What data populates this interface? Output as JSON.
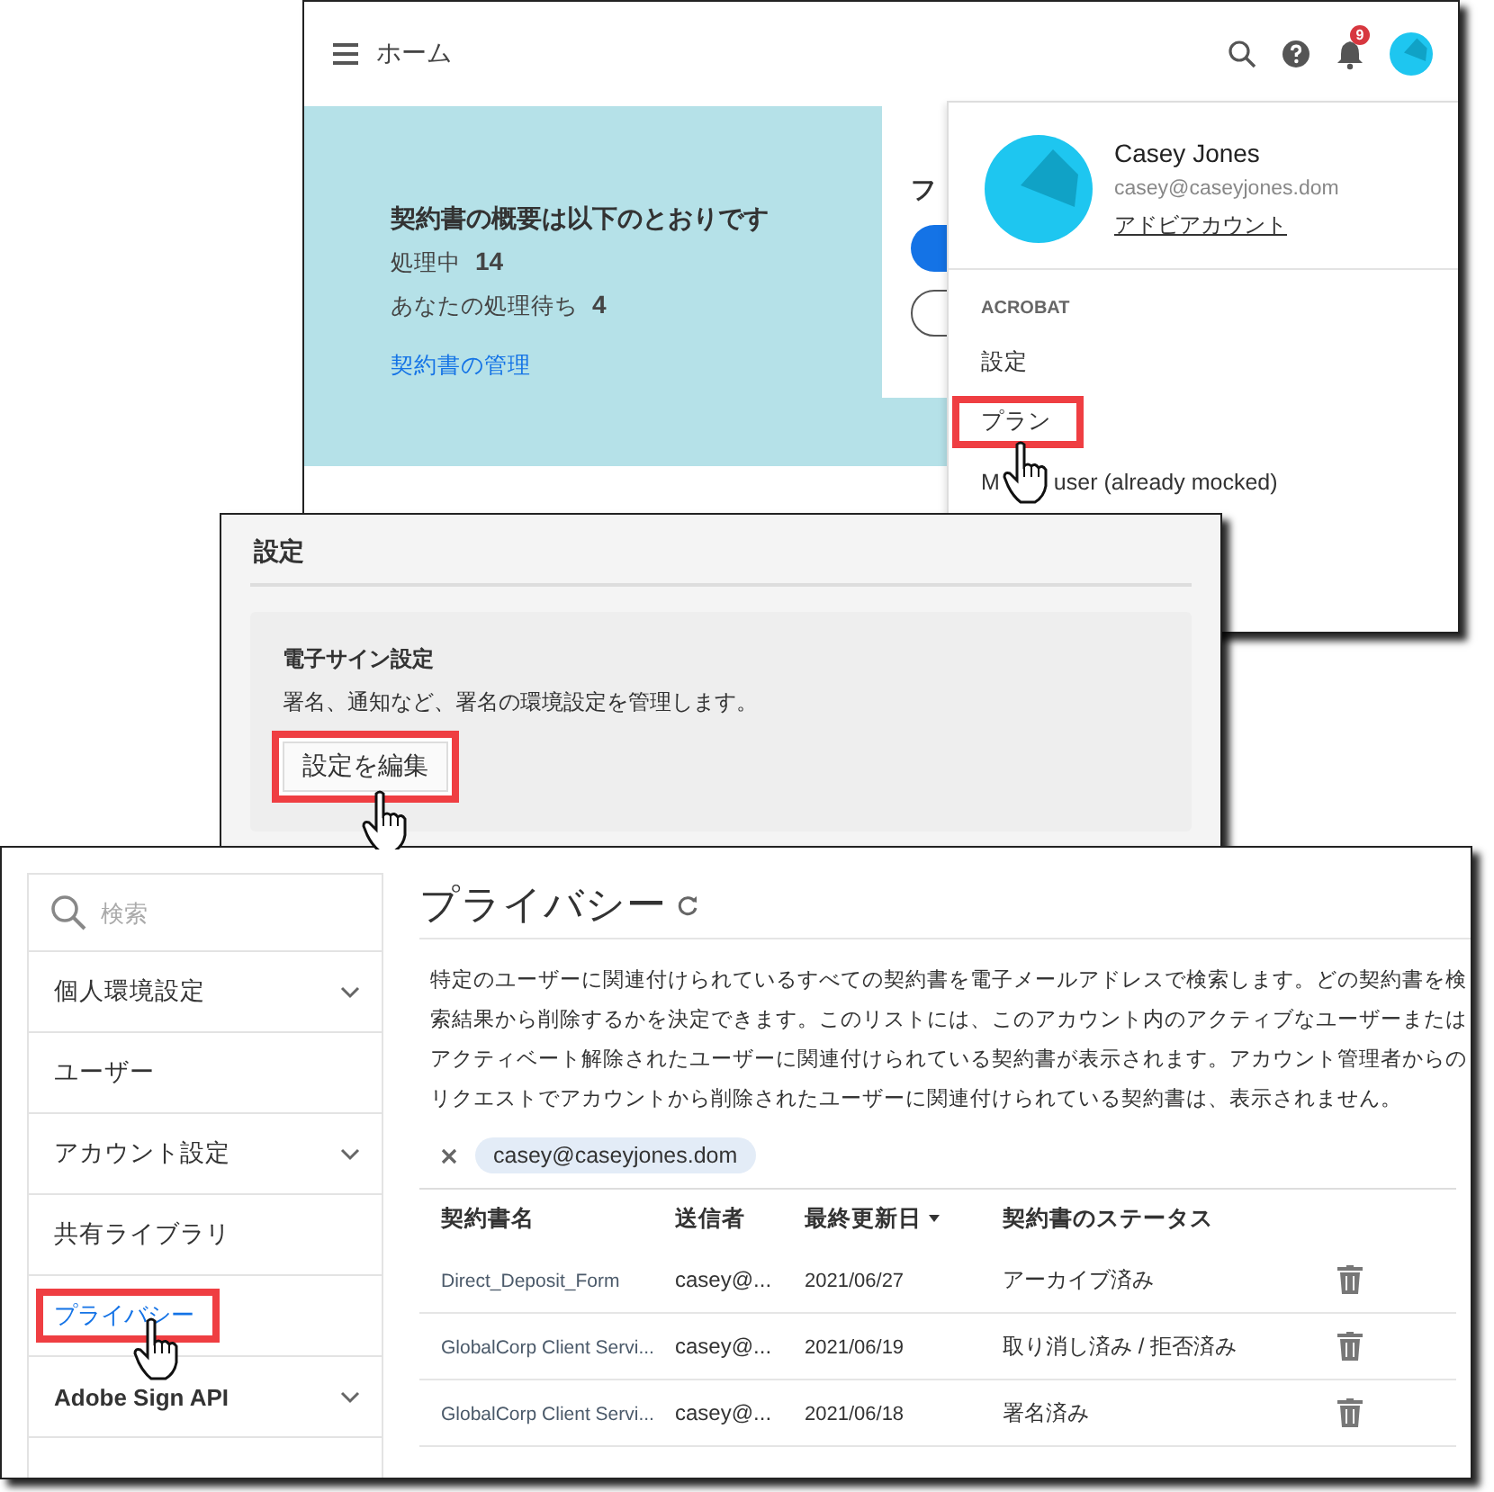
{
  "home_window": {
    "header": {
      "title": "ホーム",
      "notification_count": "9"
    },
    "summary": {
      "heading": "契約書の概要は以下のとおりです",
      "stats": [
        {
          "label": "処理中",
          "value": "14"
        },
        {
          "label": "あなたの処理待ち",
          "value": "4"
        }
      ],
      "link": "契約書の管理"
    },
    "card": {
      "heading": "フ"
    },
    "account_menu": {
      "name": "Casey Jones",
      "email": "casey@caseyjones.dom",
      "account_link": "アドビアカウント",
      "section": "ACROBAT",
      "items": [
        {
          "label": "設定",
          "highlighted": false
        },
        {
          "label": "プラン",
          "highlighted": true
        },
        {
          "label": "M",
          "trailing": "user (already mocked)",
          "highlighted": false
        }
      ]
    }
  },
  "settings_window": {
    "title": "設定",
    "section": {
      "heading": "電子サイン設定",
      "description": "署名、通知など、署名の環境設定を管理します。",
      "button": "設定を編集",
      "highlighted": true
    }
  },
  "privacy_window": {
    "search": {
      "placeholder": "検索"
    },
    "nav": [
      {
        "label": "個人環境設定",
        "expandable": true,
        "emphasized": false,
        "selected": false
      },
      {
        "label": "ユーザー",
        "expandable": false,
        "emphasized": false,
        "selected": false
      },
      {
        "label": "アカウント設定",
        "expandable": true,
        "emphasized": false,
        "selected": false
      },
      {
        "label": "共有ライブラリ",
        "expandable": false,
        "emphasized": false,
        "selected": false
      },
      {
        "label": "プライバシー",
        "expandable": false,
        "emphasized": false,
        "selected": true
      },
      {
        "label": "Adobe Sign API",
        "expandable": true,
        "emphasized": true,
        "selected": false
      }
    ],
    "title": "プライバシー",
    "description": "特定のユーザーに関連付けられているすべての契約書を電子メールアドレスで検索します。どの契約書を検索結果から削除するかを決定できます。このリストには、このアカウント内のアクティブなユーザーまたはアクティベート解除されたユーザーに関連付けられている契約書が表示されます。アカウント管理者からのリクエストでアカウントから削除されたユーザーに関連付けられている契約書は、表示されません。",
    "filter_chip": "casey@caseyjones.dom",
    "table": {
      "columns": [
        {
          "label": "契約書名",
          "sorted": false
        },
        {
          "label": "送信者",
          "sorted": false
        },
        {
          "label": "最終更新日",
          "sorted": true
        },
        {
          "label": "契約書のステータス",
          "sorted": false
        }
      ],
      "rows": [
        {
          "name": "Direct_Deposit_Form",
          "sender": "casey@...",
          "date": "2021/06/27",
          "status": "アーカイブ済み"
        },
        {
          "name": "GlobalCorp Client Servi...",
          "sender": "casey@...",
          "date": "2021/06/19",
          "status": "取り消し済み / 拒否済み"
        },
        {
          "name": "GlobalCorp Client Servi...",
          "sender": "casey@...",
          "date": "2021/06/18",
          "status": "署名済み"
        }
      ]
    }
  }
}
